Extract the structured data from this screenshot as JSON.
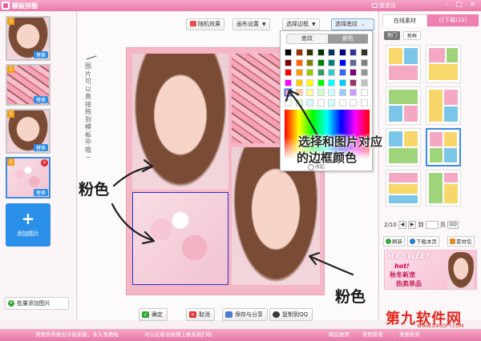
{
  "window": {
    "title": "模板拼图",
    "feedback": "提意见",
    "controls": {
      "minimize": "–",
      "maximize": "□",
      "close": "×"
    }
  },
  "left_panel": {
    "thumbnails": [
      {
        "number": "1",
        "replace_label": "替换"
      },
      {
        "number": "2",
        "replace_label": "替换"
      },
      {
        "number": "3",
        "replace_label": "替换"
      },
      {
        "number": "4",
        "replace_label": "替换",
        "delete_label": "×"
      }
    ],
    "add_photo_plus": "+",
    "add_photo_label": "添加图片",
    "batch_add_icon": "+",
    "batch_add_label": "批量添加图片"
  },
  "toolbar": {
    "random_effect": "随机效果",
    "canvas_settings": "画布设置",
    "choose_border": "选择边框",
    "choose_pattern": "选择底纹",
    "caret": "▼",
    "pattern_caret": "⌄"
  },
  "color_panel": {
    "tab_pattern": "底纹",
    "tab_color": "颜色",
    "collapse_icon": "^",
    "collapse_label": "收起",
    "swatch_rows": [
      [
        "#000000",
        "#993300",
        "#333300",
        "#003300",
        "#003366",
        "#000080",
        "#333399",
        "#333333"
      ],
      [
        "#800000",
        "#ff6600",
        "#808000",
        "#008000",
        "#008080",
        "#0000ff",
        "#666699",
        "#808080"
      ],
      [
        "#ff0000",
        "#ff9900",
        "#99cc00",
        "#339966",
        "#33cccc",
        "#3366ff",
        "#800080",
        "#969696"
      ],
      [
        "#ff00ff",
        "#ffcc00",
        "#ffff00",
        "#00ff00",
        "#00ffff",
        "#00ccff",
        "#993366",
        "#c0c0c0"
      ],
      [
        "#ff99cc",
        "#ffcc99",
        "#ffff99",
        "#ccffcc",
        "#ccffff",
        "#99ccff",
        "#cc99ff",
        "#ffffff"
      ],
      [
        "#ffffff",
        "#ccffcc",
        "#ccffff",
        "#ffffff",
        "#ccffff",
        "#ffffff",
        "#ffffff",
        "#ffffff"
      ]
    ],
    "selected_swatch": "#ff99cc"
  },
  "bottom_buttons": {
    "confirm_icon": "✓",
    "confirm": "确定",
    "cancel_icon": "×",
    "cancel": "取消",
    "save_share": "保存与分享",
    "copy_qq": "复制到QQ"
  },
  "right_panel": {
    "tab_online": "在线素材",
    "tab_downloaded": "已下载(22)",
    "subtab_hot": "热门",
    "subtab_new": "新鲜",
    "page_indicator": "2/10",
    "prev": "◀",
    "next": "▶",
    "goto_label": "到",
    "page_label": "页",
    "go_label": "GO",
    "refresh": "刷新",
    "download_page": "下载本页",
    "material_pack": "素材包",
    "promo": {
      "brand": "MY SWEET",
      "hot": "hot!",
      "line1": "秋冬新宠",
      "line2": "热卖单品"
    }
  },
  "status_bar": {
    "item1": "美图秀秀推出手机新版，永久免费啦",
    "item2": "可以在新浪微博上联系我们啦",
    "item3": "精品推荐",
    "item4": "美图看看",
    "item5": "美图秀秀"
  },
  "watermark": {
    "brand": "第九软件网",
    "url": "WWW.D9SOFT.COM"
  },
  "annotations": {
    "drag_hint": "图片可以直接拖到模板中哦~",
    "pink_left": "粉色",
    "pink_bottom": "粉色",
    "border_color_line1": "选择和图片对应",
    "border_color_line2": "的边框颜色"
  }
}
